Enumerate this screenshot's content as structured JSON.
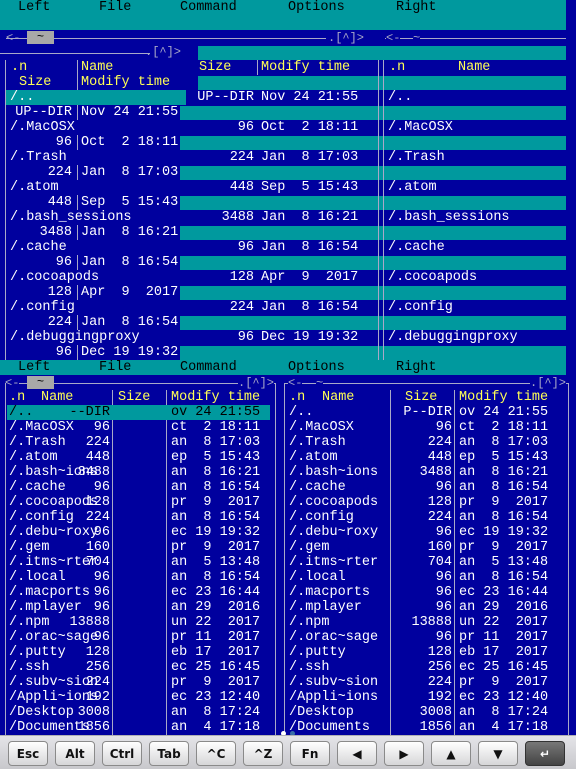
{
  "menu": {
    "items": [
      "Left",
      "File",
      "Command",
      "Options",
      "Right"
    ]
  },
  "frame": {
    "left_path": "~",
    "right_path": "~",
    "back_arrow": "<-",
    "top_indicator": ".[^]>"
  },
  "top_view": {
    "headers": {
      "n": ".n",
      "name": "Name",
      "size": "Size",
      "mtime": "Modify time"
    },
    "rows": [
      {
        "name": "/..",
        "size": "UP--DIR",
        "mtime": "Nov 24 21:55"
      },
      {
        "name": "/.MacOSX",
        "size": "96",
        "mtime": "Oct  2 18:11"
      },
      {
        "name": "/.Trash",
        "size": "224",
        "mtime": "Jan  8 17:03"
      },
      {
        "name": "/.atom",
        "size": "448",
        "mtime": "Sep  5 15:43"
      },
      {
        "name": "/.bash_sessions",
        "size": "3488",
        "mtime": "Jan  8 16:21"
      },
      {
        "name": "/.cache",
        "size": "96",
        "mtime": "Jan  8 16:54"
      },
      {
        "name": "/.cocoapods",
        "size": "128",
        "mtime": "Apr  9  2017"
      },
      {
        "name": "/.config",
        "size": "224",
        "mtime": "Jan  8 16:54"
      },
      {
        "name": "/.debuggingproxy",
        "size": "96",
        "mtime": "Dec 19 19:32"
      }
    ]
  },
  "left_panel": {
    "headers": {
      "n": ".n",
      "name": "Name",
      "size": "Size",
      "mtime": "Modify time"
    },
    "rows": [
      {
        "name": "/..",
        "size": "--DIR",
        "mtime": "ov 24 21:55"
      },
      {
        "name": "/.MacOSX",
        "size": "96",
        "mtime": "ct  2 18:11"
      },
      {
        "name": "/.Trash",
        "size": "224",
        "mtime": "an  8 17:03"
      },
      {
        "name": "/.atom",
        "size": "448",
        "mtime": "ep  5 15:43"
      },
      {
        "name": "/.bash~ions",
        "size": "3488",
        "mtime": "an  8 16:21"
      },
      {
        "name": "/.cache",
        "size": "96",
        "mtime": "an  8 16:54"
      },
      {
        "name": "/.cocoapods",
        "size": "128",
        "mtime": "pr  9  2017"
      },
      {
        "name": "/.config",
        "size": "224",
        "mtime": "an  8 16:54"
      },
      {
        "name": "/.debu~roxy",
        "size": "96",
        "mtime": "ec 19 19:32"
      },
      {
        "name": "/.gem",
        "size": "160",
        "mtime": "pr  9  2017"
      },
      {
        "name": "/.itms~rter",
        "size": "704",
        "mtime": "an  5 13:48"
      },
      {
        "name": "/.local",
        "size": "96",
        "mtime": "an  8 16:54"
      },
      {
        "name": "/.macports",
        "size": "96",
        "mtime": "ec 23 16:44"
      },
      {
        "name": "/.mplayer",
        "size": "96",
        "mtime": "an 29  2016"
      },
      {
        "name": "/.npm",
        "size": "13888",
        "mtime": "un 22  2017"
      },
      {
        "name": "/.orac~sage",
        "size": "96",
        "mtime": "pr 11  2017"
      },
      {
        "name": "/.putty",
        "size": "128",
        "mtime": "eb 17  2017"
      },
      {
        "name": "/.ssh",
        "size": "256",
        "mtime": "ec 25 16:45"
      },
      {
        "name": "/.subv~sion",
        "size": "224",
        "mtime": "pr  9  2017"
      },
      {
        "name": "/Appli~ions",
        "size": "192",
        "mtime": "ec 23 12:40"
      },
      {
        "name": "/Desktop",
        "size": "3008",
        "mtime": "an  8 17:24"
      },
      {
        "name": "/Documents",
        "size": "1856",
        "mtime": "an  4 17:18"
      }
    ]
  },
  "right_panel": {
    "headers": {
      "n": ".n",
      "name": "Name",
      "size": "Size",
      "mtime": "Modify time"
    },
    "rows": [
      {
        "name": "/..",
        "size": "P--DIR",
        "mtime": "ov 24 21:55"
      },
      {
        "name": "/.MacOSX",
        "size": "96",
        "mtime": "ct  2 18:11"
      },
      {
        "name": "/.Trash",
        "size": "224",
        "mtime": "an  8 17:03"
      },
      {
        "name": "/.atom",
        "size": "448",
        "mtime": "ep  5 15:43"
      },
      {
        "name": "/.bash~ions",
        "size": "3488",
        "mtime": "an  8 16:21"
      },
      {
        "name": "/.cache",
        "size": "96",
        "mtime": "an  8 16:54"
      },
      {
        "name": "/.cocoapods",
        "size": "128",
        "mtime": "pr  9  2017"
      },
      {
        "name": "/.config",
        "size": "224",
        "mtime": "an  8 16:54"
      },
      {
        "name": "/.debu~roxy",
        "size": "96",
        "mtime": "ec 19 19:32"
      },
      {
        "name": "/.gem",
        "size": "160",
        "mtime": "pr  9  2017"
      },
      {
        "name": "/.itms~rter",
        "size": "704",
        "mtime": "an  5 13:48"
      },
      {
        "name": "/.local",
        "size": "96",
        "mtime": "an  8 16:54"
      },
      {
        "name": "/.macports",
        "size": "96",
        "mtime": "ec 23 16:44"
      },
      {
        "name": "/.mplayer",
        "size": "96",
        "mtime": "an 29  2016"
      },
      {
        "name": "/.npm",
        "size": "13888",
        "mtime": "un 22  2017"
      },
      {
        "name": "/.orac~sage",
        "size": "96",
        "mtime": "pr 11  2017"
      },
      {
        "name": "/.putty",
        "size": "128",
        "mtime": "eb 17  2017"
      },
      {
        "name": "/.ssh",
        "size": "256",
        "mtime": "ec 25 16:45"
      },
      {
        "name": "/.subv~sion",
        "size": "224",
        "mtime": "pr  9  2017"
      },
      {
        "name": "/Appli~ions",
        "size": "192",
        "mtime": "ec 23 12:40"
      },
      {
        "name": "/Desktop",
        "size": "3008",
        "mtime": "an  8 17:24"
      },
      {
        "name": "/Documents",
        "size": "1856",
        "mtime": "an  4 17:18"
      }
    ]
  },
  "keybar": {
    "keys": [
      {
        "label": "Esc",
        "name": "esc-key"
      },
      {
        "label": "Alt",
        "name": "alt-key"
      },
      {
        "label": "Ctrl",
        "name": "ctrl-key"
      },
      {
        "label": "Tab",
        "name": "tab-key"
      },
      {
        "label": "^C",
        "name": "ctrl-c-key"
      },
      {
        "label": "^Z",
        "name": "ctrl-z-key"
      },
      {
        "label": "Fn",
        "name": "fn-key"
      },
      {
        "label": "◀",
        "name": "left-arrow-key"
      },
      {
        "label": "▶",
        "name": "right-arrow-key"
      },
      {
        "label": "▲",
        "name": "up-arrow-key"
      },
      {
        "label": "▼",
        "name": "down-arrow-key"
      },
      {
        "label": "↵",
        "name": "return-key"
      }
    ],
    "page_dots": 2,
    "active_page": 2
  }
}
